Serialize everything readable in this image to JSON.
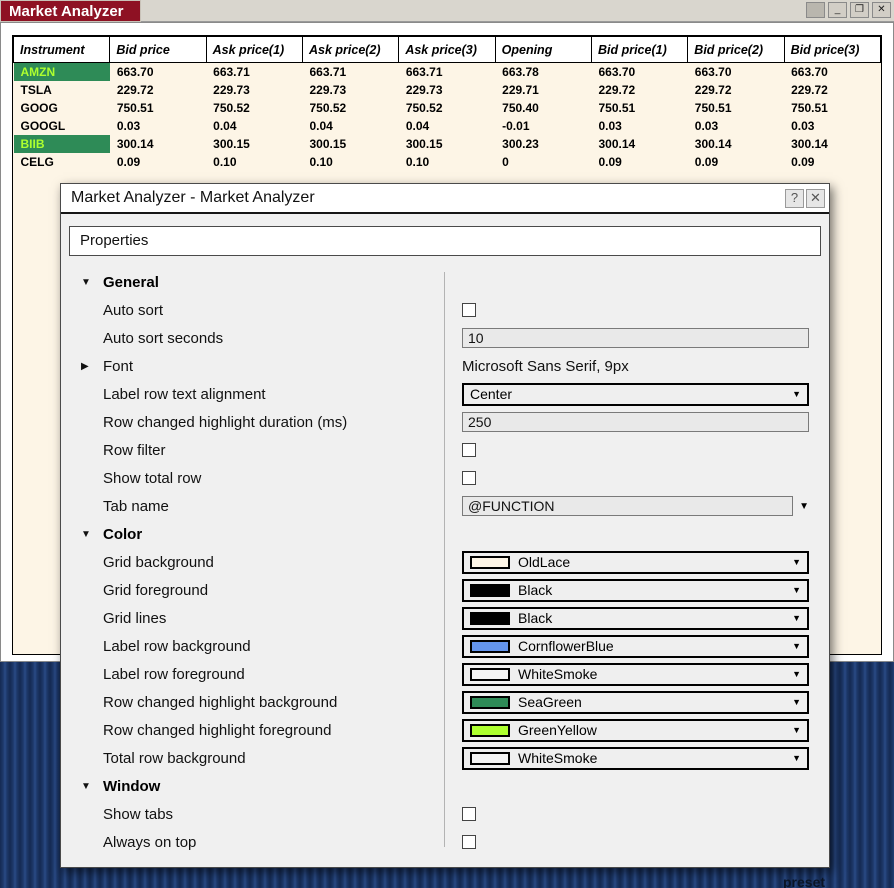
{
  "app": {
    "title": "Market Analyzer",
    "window_buttons": [
      {
        "name": "system",
        "glyph": ""
      },
      {
        "name": "minimize",
        "glyph": "_"
      },
      {
        "name": "restore",
        "glyph": "❐"
      },
      {
        "name": "close",
        "glyph": "✕"
      }
    ]
  },
  "table": {
    "columns": [
      "Instrument",
      "Bid price",
      "Ask price(1)",
      "Ask price(2)",
      "Ask price(3)",
      "Opening",
      "Bid price(1)",
      "Bid price(2)",
      "Bid price(3)"
    ],
    "rows": [
      {
        "instrument": "AMZN",
        "highlight": true,
        "values": [
          "663.70",
          "663.71",
          "663.71",
          "663.71",
          "663.78",
          "663.70",
          "663.70",
          "663.70"
        ]
      },
      {
        "instrument": "TSLA",
        "highlight": false,
        "values": [
          "229.72",
          "229.73",
          "229.73",
          "229.73",
          "229.71",
          "229.72",
          "229.72",
          "229.72"
        ]
      },
      {
        "instrument": "GOOG",
        "highlight": false,
        "values": [
          "750.51",
          "750.52",
          "750.52",
          "750.52",
          "750.40",
          "750.51",
          "750.51",
          "750.51"
        ]
      },
      {
        "instrument": "GOOGL",
        "highlight": false,
        "values": [
          "0.03",
          "0.04",
          "0.04",
          "0.04",
          "-0.01",
          "0.03",
          "0.03",
          "0.03"
        ]
      },
      {
        "instrument": "BIIB",
        "highlight": true,
        "values": [
          "300.14",
          "300.15",
          "300.15",
          "300.15",
          "300.23",
          "300.14",
          "300.14",
          "300.14"
        ]
      },
      {
        "instrument": "CELG",
        "highlight": false,
        "values": [
          "0.09",
          "0.10",
          "0.10",
          "0.10",
          "0",
          "0.09",
          "0.09",
          "0.09"
        ]
      }
    ],
    "highlight_bg": "#2E8B57",
    "highlight_fg": "#ADFF2F",
    "grid_bg": "#FDF5E6"
  },
  "dialog": {
    "title": "Market Analyzer - Market Analyzer",
    "help_label": "?",
    "close_label": "✕",
    "tab_label": "Properties",
    "sections": [
      {
        "label": "General",
        "expanded": true,
        "rows": [
          {
            "type": "checkbox",
            "label": "Auto sort",
            "checked": false
          },
          {
            "type": "text",
            "label": "Auto sort seconds",
            "value": "10"
          },
          {
            "type": "fontlabel",
            "label": "Font",
            "value": "Microsoft Sans Serif, 9px",
            "expanded": false
          },
          {
            "type": "dropdown",
            "label": "Label row text alignment",
            "value": "Center"
          },
          {
            "type": "text",
            "label": "Row changed highlight duration (ms)",
            "value": "250"
          },
          {
            "type": "checkbox",
            "label": "Row filter",
            "checked": false
          },
          {
            "type": "checkbox",
            "label": "Show total row",
            "checked": false
          },
          {
            "type": "combotext",
            "label": "Tab name",
            "value": "@FUNCTION"
          }
        ]
      },
      {
        "label": "Color",
        "expanded": true,
        "rows": [
          {
            "type": "color",
            "label": "Grid background",
            "value": "OldLace",
            "swatch": "#FDF5E6"
          },
          {
            "type": "color",
            "label": "Grid foreground",
            "value": "Black",
            "swatch": "#000000"
          },
          {
            "type": "color",
            "label": "Grid lines",
            "value": "Black",
            "swatch": "#000000"
          },
          {
            "type": "color",
            "label": "Label row background",
            "value": "CornflowerBlue",
            "swatch": "#6495ED"
          },
          {
            "type": "color",
            "label": "Label row foreground",
            "value": "WhiteSmoke",
            "swatch": "#F5F5F5"
          },
          {
            "type": "color",
            "label": "Row changed highlight background",
            "value": "SeaGreen",
            "swatch": "#2E8B57"
          },
          {
            "type": "color",
            "label": "Row changed highlight foreground",
            "value": "GreenYellow",
            "swatch": "#ADFF2F"
          },
          {
            "type": "color",
            "label": "Total row background",
            "value": "WhiteSmoke",
            "swatch": "#F5F5F5"
          }
        ]
      },
      {
        "label": "Window",
        "expanded": true,
        "rows": [
          {
            "type": "checkbox",
            "label": "Show tabs",
            "checked": false
          },
          {
            "type": "checkbox",
            "label": "Always on top",
            "checked": false
          }
        ]
      }
    ]
  },
  "footer": {
    "preset_label": "preset"
  }
}
